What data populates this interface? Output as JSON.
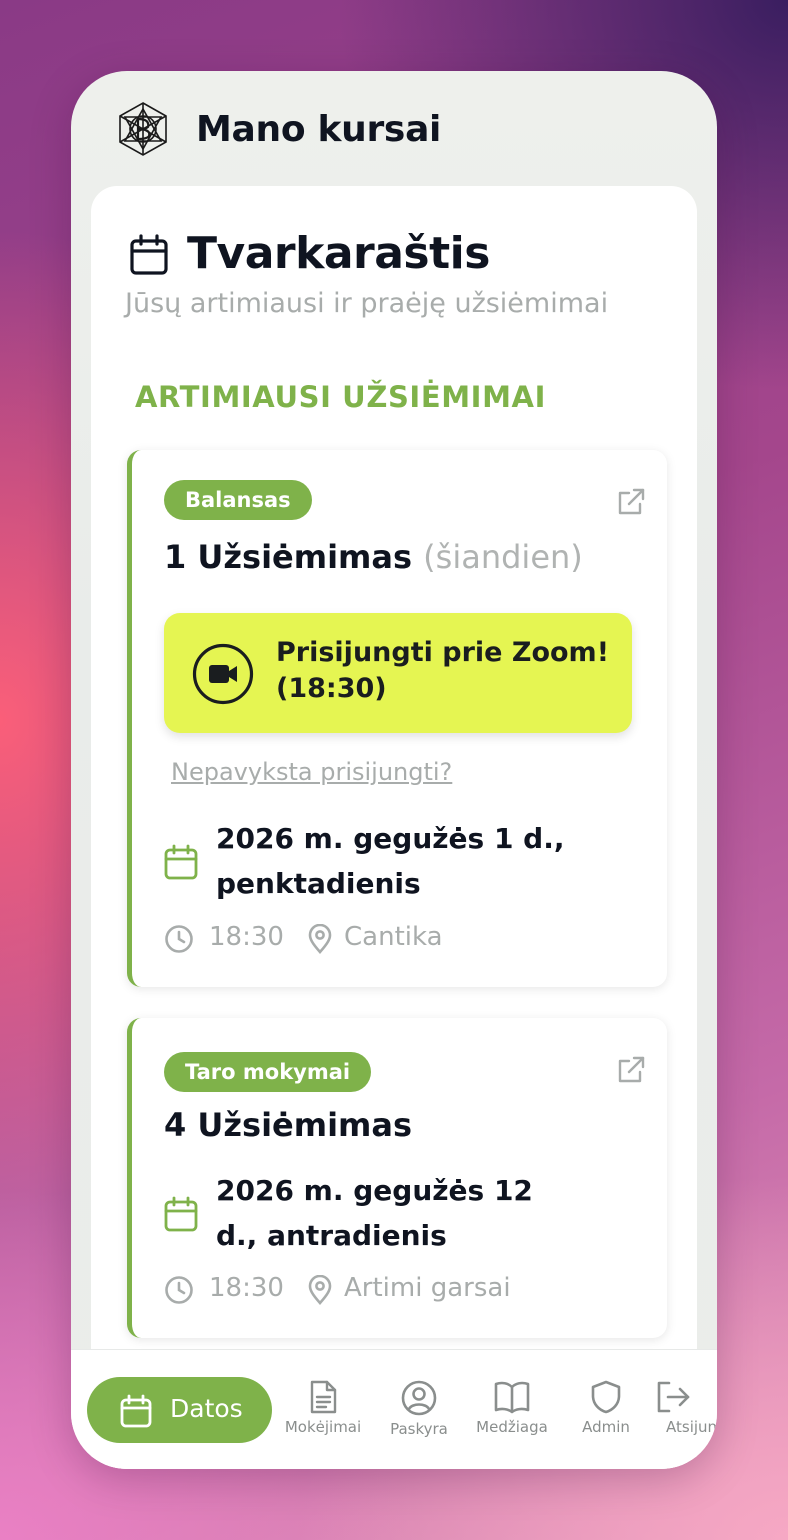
{
  "app": {
    "title": "Mano kursai"
  },
  "schedule": {
    "title": "Tvarkaraštis",
    "subtitle": "Jūsų artimiausi ir praėję užsiėmimai",
    "upcoming_heading": "ARTIMIAUSI UŽSIĖMIMAI"
  },
  "sessions": [
    {
      "badge": "Balansas",
      "title": "1 Užsiėmimas",
      "title_suffix": "(šiandien)",
      "zoom_label": "Prisijungti prie Zoom! (18:30)",
      "trouble_link": "Nepavyksta prisijungti?",
      "date": "2026 m. gegužės 1 d., penktadienis",
      "time": "18:30",
      "location": "Cantika"
    },
    {
      "badge": "Taro mokymai",
      "title": "4 Užsiėmimas",
      "date": "2026 m. gegužės 12 d., antradienis",
      "time": "18:30",
      "location": "Artimi garsai"
    }
  ],
  "nav": {
    "items": [
      {
        "label": "Datos",
        "icon": "calendar-icon",
        "active": true
      },
      {
        "label": "Mokėjimai",
        "icon": "document-icon"
      },
      {
        "label": "Paskyra",
        "icon": "user-circle-icon"
      },
      {
        "label": "Medžiaga",
        "icon": "book-icon"
      },
      {
        "label": "Admin",
        "icon": "shield-icon"
      },
      {
        "label": "Atsijun",
        "icon": "logout-icon"
      }
    ]
  },
  "colors": {
    "accent": "#7fb24a",
    "zoom_button": "#e5f552",
    "text_dark": "#0f1420",
    "text_muted": "#a8acab"
  }
}
